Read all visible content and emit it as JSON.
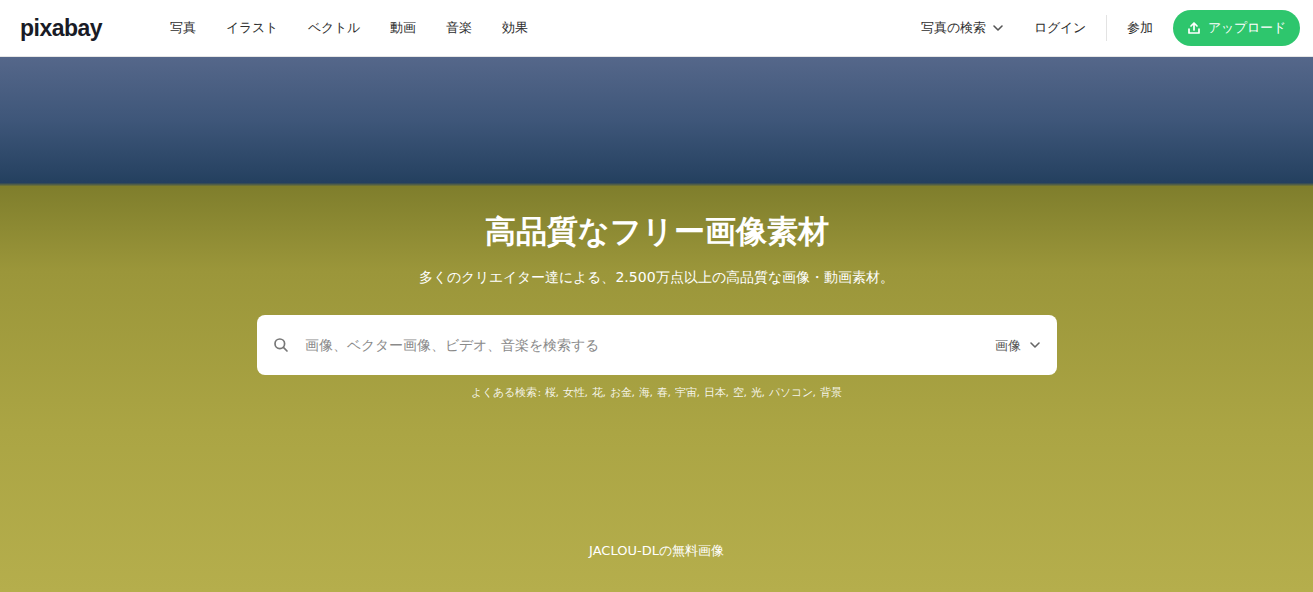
{
  "logo": "pixabay",
  "nav": [
    "写真",
    "イラスト",
    "ベクトル",
    "動画",
    "音楽",
    "効果"
  ],
  "header_right": {
    "search_type": "写真の検索",
    "login": "ログイン",
    "join": "参加",
    "upload": "アップロード"
  },
  "hero": {
    "title": "高品質なフリー画像素材",
    "subtitle": "多くのクリエイター達による、2.500万点以上の高品質な画像・動画素材。",
    "credit": "JACLOU-DLの無料画像"
  },
  "search": {
    "placeholder": "画像、ベクター画像、ビデオ、音楽を検索する",
    "type": "画像"
  },
  "popular": {
    "label": "よくある検索:",
    "separator": ",",
    "terms": [
      "桜",
      "女性",
      "花",
      "お金",
      "海",
      "春",
      "宇宙",
      "日本",
      "空",
      "光",
      "パソコン",
      "背景"
    ]
  }
}
